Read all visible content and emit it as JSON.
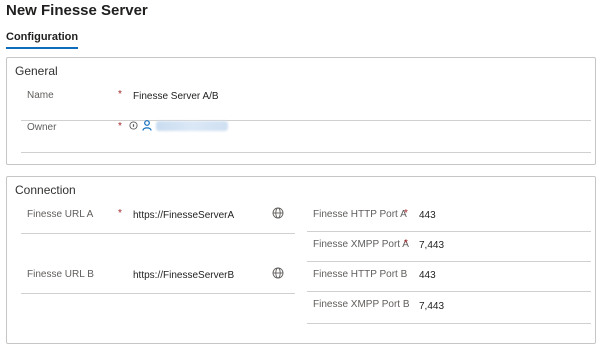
{
  "page": {
    "title": "New Finesse Server"
  },
  "tabs": [
    {
      "label": "Configuration"
    }
  ],
  "general": {
    "title": "General",
    "name": {
      "label": "Name",
      "value": "Finesse Server A/B",
      "required": "*"
    },
    "owner": {
      "label": "Owner",
      "required": "*"
    }
  },
  "connection": {
    "title": "Connection",
    "url_a": {
      "label": "Finesse URL A",
      "value": "https://FinesseServerA",
      "required": "*"
    },
    "url_b": {
      "label": "Finesse URL B",
      "value": "https://FinesseServerB"
    },
    "http_port_a": {
      "label": "Finesse HTTP Port A",
      "value": "443",
      "required": "*"
    },
    "xmpp_port_a": {
      "label": "Finesse XMPP Port A",
      "value": "7,443",
      "required": "*"
    },
    "http_port_b": {
      "label": "Finesse HTTP Port B",
      "value": "443"
    },
    "xmpp_port_b": {
      "label": "Finesse XMPP Port B",
      "value": "7,443"
    }
  },
  "colors": {
    "accent": "#0f6cbd",
    "required": "#a4262c",
    "border": "#c8c6c4"
  },
  "icons": {
    "globe": "globe-icon",
    "lock": "lock-icon",
    "person": "person-icon"
  }
}
